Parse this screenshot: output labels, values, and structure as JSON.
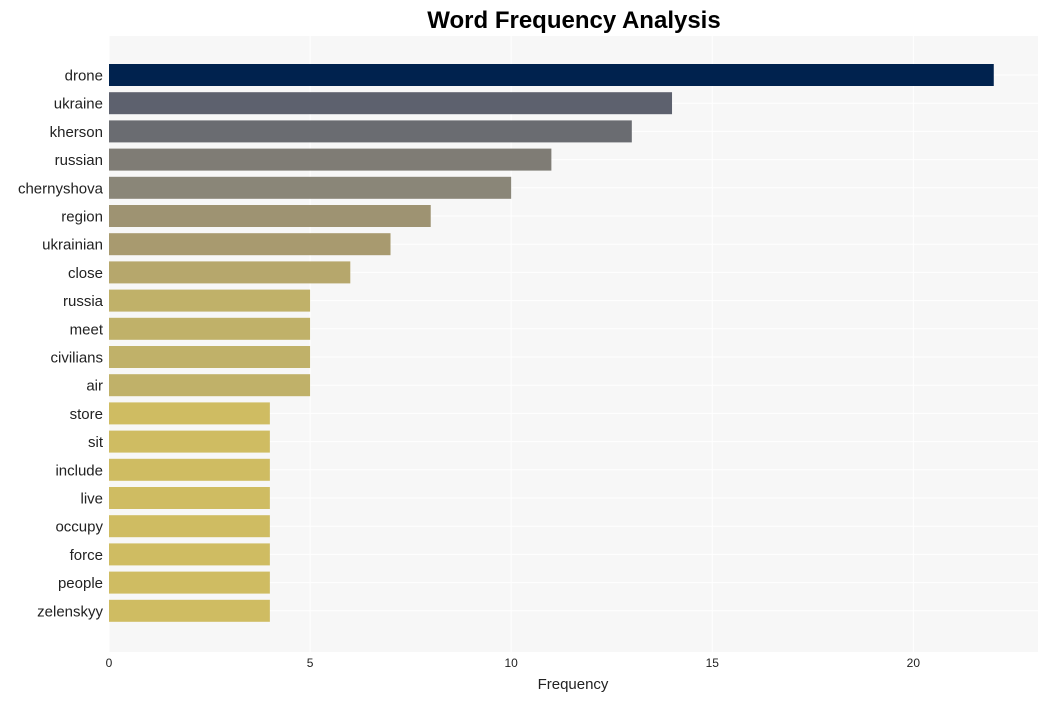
{
  "chart_data": {
    "type": "bar",
    "orientation": "horizontal",
    "title": "Word Frequency Analysis",
    "xlabel": "Frequency",
    "ylabel": "",
    "xlim": [
      0,
      23.1
    ],
    "xticks": [
      0,
      5,
      10,
      15,
      20
    ],
    "grid": true,
    "legend": "none",
    "categories": [
      "drone",
      "ukraine",
      "kherson",
      "russian",
      "chernyshova",
      "region",
      "ukrainian",
      "close",
      "russia",
      "meet",
      "civilians",
      "air",
      "store",
      "sit",
      "include",
      "live",
      "occupy",
      "force",
      "people",
      "zelenskyy"
    ],
    "values": [
      22,
      14,
      13,
      11,
      10,
      8,
      7,
      6,
      5,
      5,
      5,
      5,
      4,
      4,
      4,
      4,
      4,
      4,
      4,
      4
    ],
    "colors": [
      "#00224e",
      "#5d616e",
      "#6a6c71",
      "#7f7c75",
      "#8a8678",
      "#9e9372",
      "#a89a6f",
      "#b6a76c",
      "#c0b169",
      "#c0b169",
      "#c0b169",
      "#c0b169",
      "#cfbc62",
      "#cfbc62",
      "#cfbc62",
      "#cfbc62",
      "#cfbc62",
      "#cfbc62",
      "#cfbc62",
      "#cfbc62"
    ]
  },
  "style": {
    "plot_background": "#f7f7f7",
    "grid_color": "#ffffff"
  }
}
